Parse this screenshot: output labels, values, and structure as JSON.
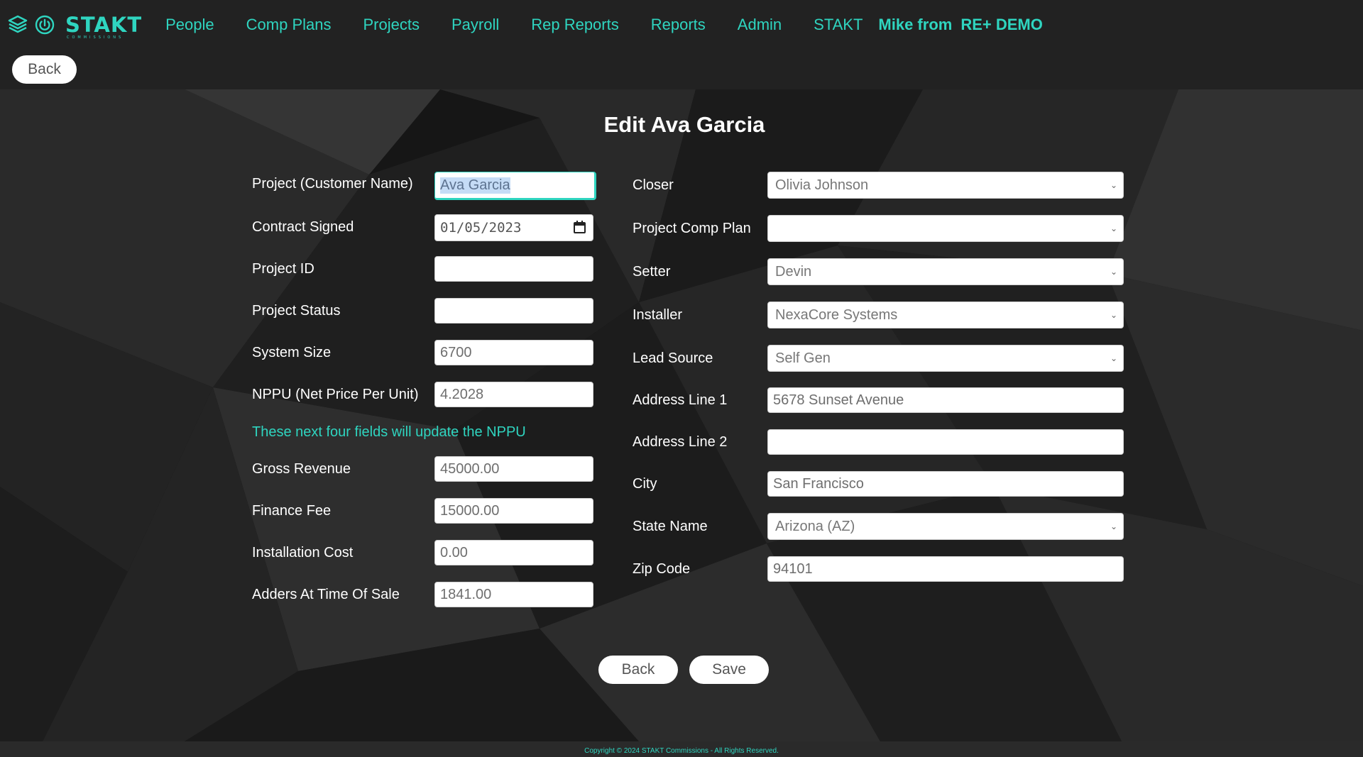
{
  "nav": {
    "logo_text": "STAKT",
    "logo_subtext": "COMMISSIONS",
    "links": [
      "People",
      "Comp Plans",
      "Projects",
      "Payroll",
      "Rep Reports",
      "Reports",
      "Admin",
      "STAKT"
    ],
    "user_label": "Mike from",
    "org_label": "RE+ DEMO",
    "brand_color": "#2fd5c0"
  },
  "top_back_label": "Back",
  "page_title": "Edit Ava Garcia",
  "left_fields": [
    {
      "label": "Project (Customer Name)",
      "value": "Ava Garcia"
    },
    {
      "label": "Contract Signed",
      "value": "01/05/2023"
    },
    {
      "label": "Project ID",
      "value": ""
    },
    {
      "label": "Project Status",
      "value": ""
    },
    {
      "label": "System Size",
      "value": "6700"
    },
    {
      "label": "NPPU (Net Price Per Unit)",
      "value": "4.2028"
    }
  ],
  "hint": "These next four fields will update the NPPU",
  "cost_fields": [
    {
      "label": "Gross Revenue",
      "value": "45000.00"
    },
    {
      "label": "Finance Fee",
      "value": "15000.00"
    },
    {
      "label": "Installation Cost",
      "value": "0.00"
    },
    {
      "label": "Adders At Time Of Sale",
      "value": "1841.00"
    }
  ],
  "right_fields": [
    {
      "label": "Closer",
      "value": "Olivia Johnson",
      "type": "select"
    },
    {
      "label": "Project Comp Plan",
      "value": "",
      "type": "select"
    },
    {
      "label": "Setter",
      "value": "Devin",
      "type": "select"
    },
    {
      "label": "Installer",
      "value": "NexaCore Systems",
      "type": "select"
    },
    {
      "label": "Lead Source",
      "value": "Self Gen",
      "type": "select"
    },
    {
      "label": "Address Line 1",
      "value": "5678 Sunset Avenue",
      "type": "text"
    },
    {
      "label": "Address Line 2",
      "value": "",
      "type": "text"
    },
    {
      "label": "City",
      "value": "San Francisco",
      "type": "text"
    },
    {
      "label": "State Name",
      "value": "Arizona (AZ)",
      "type": "select"
    },
    {
      "label": "Zip Code",
      "value": "94101",
      "type": "text"
    }
  ],
  "buttons": {
    "back": "Back",
    "save": "Save"
  },
  "footer": "Copyright © 2024 STAKT Commissions - All Rights Reserved."
}
